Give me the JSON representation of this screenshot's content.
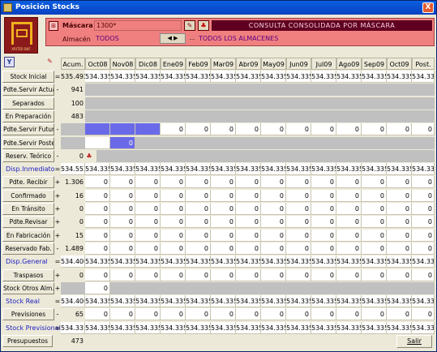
{
  "window": {
    "title": "Posición Stocks",
    "close_label": "X"
  },
  "header": {
    "mascara_label": "Máscara",
    "mascara_value": "1300*",
    "almacen_label": "Almacén",
    "almacen_value": "TODOS",
    "consulta_title": "CONSULTA CONSOLIDADA POR MÁSCARA",
    "almacenes_text": "TODOS LOS ALMACENES",
    "nav_label": "◀ ▶",
    "dots_label": "...",
    "logo_text": "XRITER BKF"
  },
  "columns": [
    "Acum.",
    "Oct08",
    "Nov08",
    "Dic08",
    "Ene09",
    "Feb09",
    "Mar09",
    "Abr09",
    "May09",
    "Jun09",
    "Jul09",
    "Ago09",
    "Sep09",
    "Oct09",
    "Post."
  ],
  "rows": [
    {
      "label": "Stock Inicial",
      "kind": "button",
      "sign": "=",
      "acum": "535.493",
      "months": [
        "534.335",
        "534.335",
        "534.335",
        "534.335",
        "534.335",
        "534.335",
        "534.335",
        "534.335",
        "534.335",
        "534.335",
        "534.335",
        "534.335",
        "534.335",
        "534.335"
      ]
    },
    {
      "label": "Pdte.Servir Actual",
      "kind": "button",
      "sign": "-",
      "acum": "941",
      "gray": true
    },
    {
      "label": "Separados",
      "kind": "button",
      "sign": "",
      "acum": "100",
      "gray": true
    },
    {
      "label": "En Preparación",
      "kind": "button",
      "sign": "",
      "acum": "483",
      "gray": true
    },
    {
      "label": "Pdte.Servir Futuro",
      "kind": "button",
      "sign": "-",
      "acum": "",
      "months": [
        "",
        "",
        "",
        "0",
        "0",
        "0",
        "0",
        "0",
        "0",
        "0",
        "0",
        "0",
        "0",
        "0"
      ],
      "purple": [
        0,
        1,
        2
      ]
    },
    {
      "label": "Pdte.Servir Poster.",
      "kind": "button",
      "sign": "",
      "acum": "",
      "months": [
        "",
        "0"
      ],
      "purple": [
        1
      ],
      "grayAfter": 2
    },
    {
      "label": "Reserv. Teórico",
      "kind": "button",
      "sign": "-",
      "acum": "0",
      "gray_from_icon": true
    },
    {
      "label": "Disp.Inmediato",
      "kind": "blue",
      "sign": "=",
      "acum": "534.552",
      "months": [
        "534.335",
        "534.335",
        "534.335",
        "534.335",
        "534.335",
        "534.335",
        "534.335",
        "534.335",
        "534.335",
        "534.335",
        "534.335",
        "534.335",
        "534.335",
        "534.335"
      ]
    },
    {
      "label": "Pdte. Recibir",
      "kind": "button",
      "sign": "+",
      "acum": "1.306",
      "months": [
        "0",
        "0",
        "0",
        "0",
        "0",
        "0",
        "0",
        "0",
        "0",
        "0",
        "0",
        "0",
        "0",
        "0"
      ]
    },
    {
      "label": "Confirmado",
      "kind": "button",
      "sign": "+",
      "acum": "16",
      "months": [
        "0",
        "0",
        "0",
        "0",
        "0",
        "0",
        "0",
        "0",
        "0",
        "0",
        "0",
        "0",
        "0",
        "0"
      ]
    },
    {
      "label": "En Tránsito",
      "kind": "button",
      "sign": "+",
      "acum": "0",
      "months": [
        "0",
        "0",
        "0",
        "0",
        "0",
        "0",
        "0",
        "0",
        "0",
        "0",
        "0",
        "0",
        "0",
        "0"
      ]
    },
    {
      "label": "Pdte.Revisar",
      "kind": "button",
      "sign": "+",
      "acum": "0",
      "months": [
        "0",
        "0",
        "0",
        "0",
        "0",
        "0",
        "0",
        "0",
        "0",
        "0",
        "0",
        "0",
        "0",
        "0"
      ]
    },
    {
      "label": "En Fabricación",
      "kind": "button",
      "sign": "+",
      "acum": "15",
      "months": [
        "0",
        "0",
        "0",
        "0",
        "0",
        "0",
        "0",
        "0",
        "0",
        "0",
        "0",
        "0",
        "0",
        "0"
      ]
    },
    {
      "label": "Reservado Fab.",
      "kind": "button",
      "sign": "-",
      "acum": "1.489",
      "months": [
        "0",
        "0",
        "0",
        "0",
        "0",
        "0",
        "0",
        "0",
        "0",
        "0",
        "0",
        "0",
        "0",
        "0"
      ]
    },
    {
      "label": "Disp.General",
      "kind": "blue",
      "sign": "=",
      "acum": "534.400",
      "months": [
        "534.335",
        "534.335",
        "534.335",
        "534.335",
        "534.335",
        "534.335",
        "534.335",
        "534.335",
        "534.335",
        "534.335",
        "534.335",
        "534.335",
        "534.335",
        "534.335"
      ]
    },
    {
      "label": "Traspasos",
      "kind": "button",
      "sign": "+",
      "acum": "0",
      "months": [
        "0",
        "0",
        "0",
        "0",
        "0",
        "0",
        "0",
        "0",
        "0",
        "0",
        "0",
        "0",
        "0",
        "0"
      ]
    },
    {
      "label": "Stock Otros Alm.",
      "kind": "button",
      "sign": "+",
      "acum": "",
      "months": [
        "0"
      ],
      "grayAfter": 1
    },
    {
      "label": "Stock Real",
      "kind": "blue",
      "sign": "=",
      "acum": "534.400",
      "months": [
        "534.335",
        "534.335",
        "534.335",
        "534.335",
        "534.335",
        "534.335",
        "534.335",
        "534.335",
        "534.335",
        "534.335",
        "534.335",
        "534.335",
        "534.335",
        "534.335"
      ]
    },
    {
      "label": "Previsiones",
      "kind": "button",
      "sign": "-",
      "acum": "65",
      "months": [
        "0",
        "0",
        "0",
        "0",
        "0",
        "0",
        "0",
        "0",
        "0",
        "0",
        "0",
        "0",
        "0",
        "0"
      ]
    },
    {
      "label": "Stock Previsional",
      "kind": "blue",
      "sign": "=",
      "acum": "534.335",
      "months": [
        "534.335",
        "534.335",
        "534.335",
        "534.335",
        "534.335",
        "534.335",
        "534.335",
        "534.335",
        "534.335",
        "534.335",
        "534.335",
        "534.335",
        "534.335",
        "534.335"
      ]
    },
    {
      "label": "Presupuestos",
      "kind": "button",
      "sign": "",
      "acum": "473",
      "wide": true
    }
  ],
  "footer": {
    "salir_label": "Salir"
  }
}
